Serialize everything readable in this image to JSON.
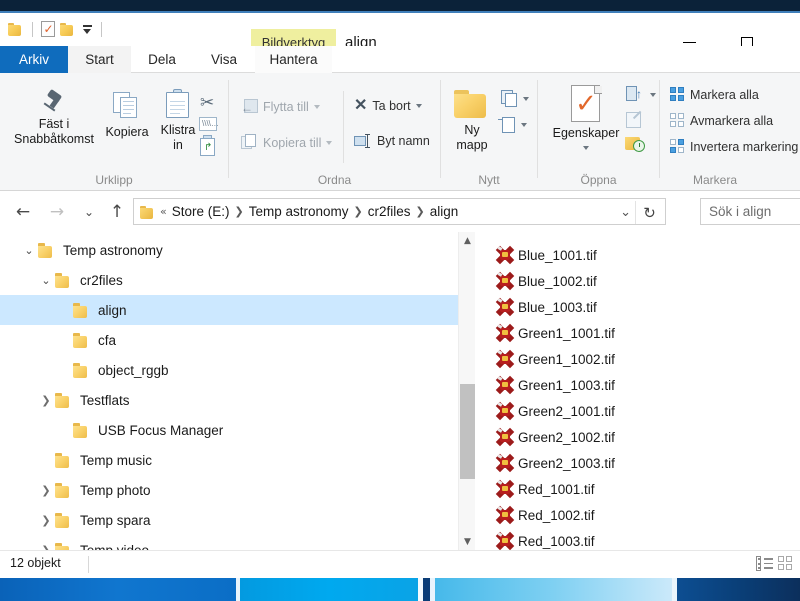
{
  "window": {
    "title": "align",
    "contextual_tab_group": "Bildverktyg",
    "minimize_label": "Minimera",
    "maximize_label": "Maximera"
  },
  "quick_access": {
    "items": [
      {
        "name": "folder-icon",
        "label": "Egenskaper för mapp"
      },
      {
        "name": "properties-icon",
        "label": "Egenskaper"
      },
      {
        "name": "new-folder-icon",
        "label": "Ny mapp"
      },
      {
        "name": "customize-dropdown-icon",
        "label": "Anpassa verktygsfältet Snabbåtkomst"
      }
    ]
  },
  "tabs": [
    {
      "label": "Arkiv",
      "state": "file"
    },
    {
      "label": "Start",
      "state": "active"
    },
    {
      "label": "Dela",
      "state": "normal"
    },
    {
      "label": "Visa",
      "state": "normal"
    },
    {
      "label": "Hantera",
      "state": "contextual"
    }
  ],
  "ribbon": {
    "groups": [
      {
        "label": "Urklipp",
        "buttons": [
          {
            "label": "Fäst i\nSnabbåtkomst",
            "line1": "Fäst i",
            "line2": "Snabbåtkomst",
            "icon": "pin-icon"
          },
          {
            "label": "Kopiera",
            "icon": "copy-icon"
          },
          {
            "label": "Klistra in",
            "line1": "Klistra",
            "line2": "in",
            "icon": "paste-icon"
          },
          {
            "label": "Klipp ut",
            "icon": "cut-icon"
          },
          {
            "label": "Kopiera sökväg",
            "icon": "copy-path-icon"
          },
          {
            "label": "Klistra in genväg",
            "icon": "paste-shortcut-icon"
          }
        ]
      },
      {
        "label": "Ordna",
        "buttons": [
          {
            "label": "Flytta till",
            "icon": "move-to-icon",
            "disabled": true
          },
          {
            "label": "Kopiera till",
            "icon": "copy-to-icon",
            "disabled": true
          },
          {
            "label": "Ta bort",
            "icon": "delete-icon",
            "disabled": false
          },
          {
            "label": "Byt namn",
            "icon": "rename-icon",
            "disabled": false
          }
        ]
      },
      {
        "label": "Nytt",
        "buttons": [
          {
            "label": "Ny mapp",
            "line1": "Ny",
            "line2": "mapp",
            "icon": "new-folder-icon"
          },
          {
            "label": "Nytt objekt",
            "icon": "new-item-icon"
          },
          {
            "label": "Enkel åtkomst",
            "icon": "easy-access-icon"
          }
        ]
      },
      {
        "label": "Öppna",
        "buttons": [
          {
            "label": "Egenskaper",
            "icon": "properties-icon"
          },
          {
            "label": "Öppna",
            "icon": "open-with-icon"
          },
          {
            "label": "Redigera",
            "icon": "edit-icon"
          },
          {
            "label": "Historik",
            "icon": "history-icon"
          }
        ]
      },
      {
        "label": "Markera",
        "buttons": [
          {
            "label": "Markera alla",
            "icon": "select-all-icon"
          },
          {
            "label": "Avmarkera alla",
            "icon": "select-none-icon"
          },
          {
            "label": "Invertera markering",
            "icon": "invert-selection-icon"
          }
        ]
      }
    ]
  },
  "navigation": {
    "back_label": "Tillbaka",
    "forward_label": "Framåt",
    "recent_label": "Senaste platser",
    "up_label": "Upp",
    "overflow": "«",
    "breadcrumbs": [
      "Store (E:)",
      "Temp astronomy",
      "cr2files",
      "align"
    ],
    "refresh_label": "Uppdatera"
  },
  "search": {
    "placeholder": "Sök i align"
  },
  "tree": [
    {
      "label": "Temp astronomy",
      "indent": 0,
      "chevron": "down",
      "selected": false
    },
    {
      "label": "cr2files",
      "indent": 1,
      "chevron": "down",
      "selected": false
    },
    {
      "label": "align",
      "indent": 2,
      "chevron": "none",
      "selected": true
    },
    {
      "label": "cfa",
      "indent": 2,
      "chevron": "none",
      "selected": false
    },
    {
      "label": "object_rggb",
      "indent": 2,
      "chevron": "none",
      "selected": false
    },
    {
      "label": "Testflats",
      "indent": 1,
      "chevron": "right",
      "selected": false
    },
    {
      "label": "USB Focus Manager",
      "indent": 2,
      "chevron": "none",
      "selected": false
    },
    {
      "label": "Temp music",
      "indent": 1,
      "chevron": "none",
      "selected": false
    },
    {
      "label": "Temp photo",
      "indent": 1,
      "chevron": "right",
      "selected": false
    },
    {
      "label": "Temp spara",
      "indent": 1,
      "chevron": "right",
      "selected": false
    },
    {
      "label": "Temp video",
      "indent": 1,
      "chevron": "right",
      "selected": false
    }
  ],
  "files": [
    {
      "name": "Blue_1001.tif",
      "icon": "tif-file-icon"
    },
    {
      "name": "Blue_1002.tif",
      "icon": "tif-file-icon"
    },
    {
      "name": "Blue_1003.tif",
      "icon": "tif-file-icon"
    },
    {
      "name": "Green1_1001.tif",
      "icon": "tif-file-icon"
    },
    {
      "name": "Green1_1002.tif",
      "icon": "tif-file-icon"
    },
    {
      "name": "Green1_1003.tif",
      "icon": "tif-file-icon"
    },
    {
      "name": "Green2_1001.tif",
      "icon": "tif-file-icon"
    },
    {
      "name": "Green2_1002.tif",
      "icon": "tif-file-icon"
    },
    {
      "name": "Green2_1003.tif",
      "icon": "tif-file-icon"
    },
    {
      "name": "Red_1001.tif",
      "icon": "tif-file-icon"
    },
    {
      "name": "Red_1002.tif",
      "icon": "tif-file-icon"
    },
    {
      "name": "Red_1003.tif",
      "icon": "tif-file-icon"
    }
  ],
  "status": {
    "item_count": "12 objekt",
    "view_details_label": "Detaljerad lista",
    "view_icons_label": "Stora ikoner"
  },
  "colors": {
    "file_tab": "#0f6cbd",
    "contextual_tab": "#efef9f",
    "selection": "#cce8ff",
    "ribbon_bg": "#f5f6f7",
    "folder_yellow": "#f9d169",
    "file_icon_red": "#b81f1f"
  }
}
